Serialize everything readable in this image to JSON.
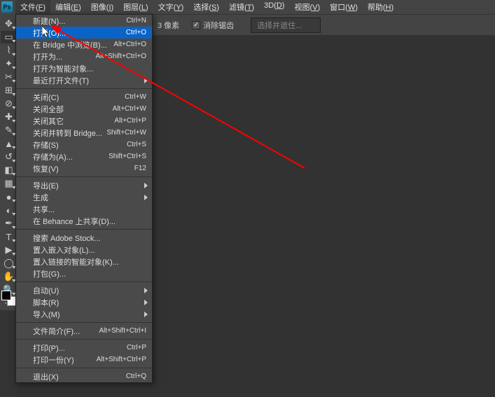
{
  "menubar": {
    "items": [
      {
        "label": "文件",
        "u": "F"
      },
      {
        "label": "编辑",
        "u": "E"
      },
      {
        "label": "图像",
        "u": "I"
      },
      {
        "label": "图层",
        "u": "L"
      },
      {
        "label": "文字",
        "u": "Y"
      },
      {
        "label": "选择",
        "u": "S"
      },
      {
        "label": "滤镜",
        "u": "T"
      },
      {
        "label": "3D",
        "u": "D"
      },
      {
        "label": "视图",
        "u": "V"
      },
      {
        "label": "窗口",
        "u": "W"
      },
      {
        "label": "帮助",
        "u": "H"
      }
    ]
  },
  "optionsbar": {
    "pixels_value": "3 像素",
    "antialias_label": "消除锯齿",
    "antialias_checked": true,
    "selection_label": "选择并遮住..."
  },
  "file_menu": {
    "items": [
      {
        "label": "新建(N)...",
        "shortcut": "Ctrl+N"
      },
      {
        "label": "打开(O)...",
        "shortcut": "Ctrl+O",
        "hover": true
      },
      {
        "label": "在 Bridge 中浏览(B)...",
        "shortcut": "Alt+Ctrl+O"
      },
      {
        "label": "打开为...",
        "shortcut": "Alt+Shift+Ctrl+O"
      },
      {
        "label": "打开为智能对象..."
      },
      {
        "label": "最近打开文件(T)",
        "submenu": true
      },
      {
        "sep": true
      },
      {
        "label": "关闭(C)",
        "shortcut": "Ctrl+W"
      },
      {
        "label": "关闭全部",
        "shortcut": "Alt+Ctrl+W"
      },
      {
        "label": "关闭其它",
        "shortcut": "Alt+Ctrl+P"
      },
      {
        "label": "关闭并转到 Bridge...",
        "shortcut": "Shift+Ctrl+W"
      },
      {
        "label": "存储(S)",
        "shortcut": "Ctrl+S"
      },
      {
        "label": "存储为(A)...",
        "shortcut": "Shift+Ctrl+S"
      },
      {
        "label": "恢复(V)",
        "shortcut": "F12"
      },
      {
        "sep": true
      },
      {
        "label": "导出(E)",
        "submenu": true
      },
      {
        "label": "生成",
        "submenu": true
      },
      {
        "label": "共享..."
      },
      {
        "label": "在 Behance 上共享(D)..."
      },
      {
        "sep": true
      },
      {
        "label": "搜索 Adobe Stock..."
      },
      {
        "label": "置入嵌入对象(L)..."
      },
      {
        "label": "置入链接的智能对象(K)..."
      },
      {
        "label": "打包(G)..."
      },
      {
        "sep": true
      },
      {
        "label": "自动(U)",
        "submenu": true
      },
      {
        "label": "脚本(R)",
        "submenu": true
      },
      {
        "label": "导入(M)",
        "submenu": true
      },
      {
        "sep": true
      },
      {
        "label": "文件简介(F)...",
        "shortcut": "Alt+Shift+Ctrl+I"
      },
      {
        "sep": true
      },
      {
        "label": "打印(P)...",
        "shortcut": "Ctrl+P"
      },
      {
        "label": "打印一份(Y)",
        "shortcut": "Alt+Shift+Ctrl+P"
      },
      {
        "sep": true
      },
      {
        "label": "退出(X)",
        "shortcut": "Ctrl+Q"
      }
    ]
  },
  "tools": [
    {
      "name": "move-tool",
      "glyph": "✥"
    },
    {
      "name": "marquee-tool",
      "glyph": "▭"
    },
    {
      "name": "lasso-tool",
      "glyph": "⌇"
    },
    {
      "name": "quick-select-tool",
      "glyph": "✦"
    },
    {
      "name": "crop-tool",
      "glyph": "✂"
    },
    {
      "name": "frame-tool",
      "glyph": "⊞"
    },
    {
      "name": "eyedropper-tool",
      "glyph": "⊘"
    },
    {
      "name": "healing-tool",
      "glyph": "✚"
    },
    {
      "name": "brush-tool",
      "glyph": "✎"
    },
    {
      "name": "stamp-tool",
      "glyph": "▲"
    },
    {
      "name": "history-brush-tool",
      "glyph": "↺"
    },
    {
      "name": "eraser-tool",
      "glyph": "◧"
    },
    {
      "name": "gradient-tool",
      "glyph": "▦"
    },
    {
      "name": "blur-tool",
      "glyph": "●"
    },
    {
      "name": "dodge-tool",
      "glyph": "◐"
    },
    {
      "name": "pen-tool",
      "glyph": "✒"
    },
    {
      "name": "type-tool",
      "glyph": "T"
    },
    {
      "name": "path-select-tool",
      "glyph": "▶"
    },
    {
      "name": "shape-tool",
      "glyph": "◯"
    },
    {
      "name": "hand-tool",
      "glyph": "✋"
    },
    {
      "name": "zoom-tool",
      "glyph": "🔍"
    },
    {
      "name": "edit-toolbar",
      "glyph": "⋯"
    }
  ]
}
